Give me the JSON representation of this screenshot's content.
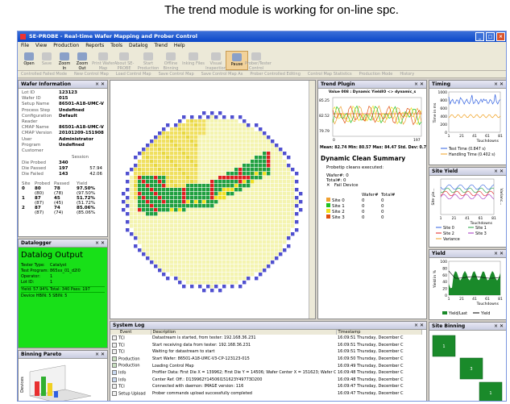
{
  "annotation": "The trend module is working for on-line spc.",
  "title": "SE-PROBE - Real-time Wafer Mapping and Prober Control",
  "menu": [
    "File",
    "View",
    "Production",
    "Reports",
    "Tools",
    "Datalog",
    "Trend",
    "Help"
  ],
  "toolbar": [
    {
      "label": "Open",
      "dis": false
    },
    {
      "label": "Save",
      "dis": true
    },
    {
      "label": "Zoom In",
      "dis": false
    },
    {
      "label": "Zoom Out",
      "dis": false
    },
    {
      "label": "Print Wafer Map",
      "dis": true
    },
    {
      "label": "About SE-PROBE",
      "dis": true
    },
    {
      "label": "Start Production",
      "dis": true
    },
    {
      "label": "Offline Binning",
      "dis": true
    },
    {
      "label": "Inking Files",
      "dis": true
    },
    {
      "label": "Visual Inspection",
      "dis": true
    },
    {
      "label": "Pause",
      "dis": false
    },
    {
      "label": "Prober/Tester Control",
      "dis": true
    }
  ],
  "toolbar2": [
    "Controlled Failed Mode",
    "New Control Map",
    "Load Control Map",
    "Save Control Map",
    "Save Control Map As",
    "Prober Controlled Editing",
    "Control Map Statistics",
    "Production Mode",
    "History"
  ],
  "wafer_info": {
    "title": "Wafer Information",
    "fields": [
      {
        "label": "Lot ID",
        "value": "123123"
      },
      {
        "label": "Wafer ID",
        "value": "015"
      },
      {
        "label": "Setup Name",
        "value": "86501-A18-UMC-V"
      },
      {
        "label": "Process Step",
        "value": "Undefined"
      },
      {
        "label": "Configuration",
        "value": "Default"
      },
      {
        "label": "Reader",
        "value": ""
      },
      {
        "label": "CMAP Name",
        "value": "86501-A18-UMC-V"
      },
      {
        "label": "CMAP Version",
        "value": "20101209-151908"
      },
      {
        "label": "User",
        "value": "Administrator"
      },
      {
        "label": "Program",
        "value": "Undefined"
      },
      {
        "label": "Customer",
        "value": ""
      }
    ],
    "session_label": "Session",
    "counts": [
      {
        "label": "Die Probed",
        "value": "340",
        "pct": ""
      },
      {
        "label": "Die Passed",
        "value": "197",
        "pct": "57.94"
      },
      {
        "label": "Die Failed",
        "value": "143",
        "pct": "42.06"
      }
    ],
    "bin_headers": [
      "Site",
      "Probed",
      "Passed",
      "Yield"
    ],
    "bins": [
      [
        "0",
        "80",
        "78",
        "97.50%"
      ],
      [
        "",
        "(80)",
        "(78)",
        "(97.50%"
      ],
      [
        "1",
        "87",
        "45",
        "51.72%"
      ],
      [
        "",
        "(87)",
        "(45)",
        "(51.72%"
      ],
      [
        "2",
        "87",
        "74",
        "85.06%"
      ],
      [
        "",
        "(87)",
        "(74)",
        "(85.06%"
      ]
    ]
  },
  "datalogger": {
    "title": "Datalogger",
    "heading": "Datalog Output",
    "fields": [
      {
        "label": "Tester Type:",
        "value": "Catalyst"
      },
      {
        "label": "Test Program:",
        "value": "865xx_01_d2l0"
      },
      {
        "label": "Operator:",
        "value": "1"
      },
      {
        "label": "Lot ID:",
        "value": "1"
      }
    ],
    "yield_line": "Yield: 57.94% Total: 340 Pass: 197",
    "device_line": "Device HBIN: 5 SBIN: 5"
  },
  "pareto": {
    "title": "Binning Pareto",
    "ylabel": "Devices"
  },
  "trend": {
    "title": "Trend Plugin",
    "header": "Value 008 : Dynamic YieldIO <> dynamic_s",
    "y_ticks": [
      "85.25",
      "82.52",
      "79.79"
    ],
    "x_ticks": [
      "0",
      "197"
    ],
    "stats": "Mean: 82.74 Min: 80.57 Max: 84.47 Std. Dev: 0.72",
    "summary_title": "Dynamic Clean Summary",
    "summary_line": "Probetip cleans executed:",
    "wafer_line": "Wafer#: 0",
    "total_line": "Total#: 0",
    "fail_device": "Fail Device",
    "site_headers": [
      "Wafer#",
      "Total#"
    ],
    "sites": [
      {
        "name": "Site 0",
        "color": "#f0a030"
      },
      {
        "name": "Site 1",
        "color": "#20c020"
      },
      {
        "name": "Site 2",
        "color": "#f0e020"
      },
      {
        "name": "Site 3",
        "color": "#e05010"
      }
    ]
  },
  "timing": {
    "title": "Timing",
    "y_ticks": [
      "1000",
      "800",
      "600",
      "400",
      "200",
      "0"
    ],
    "x_ticks": [
      "1",
      "21",
      "41",
      "61",
      "81"
    ],
    "xlabel": "Touchdowns",
    "ylabel": "Time in ms",
    "legend": [
      "Test Time (0.847 s)",
      "Handling Time (0.402 s)"
    ]
  },
  "site_yield": {
    "title": "Site Yield",
    "ylabel": "Site yie...",
    "y2label": "Varianc...",
    "x_ticks": [
      "1",
      "21",
      "41",
      "61",
      "81"
    ],
    "xlabel": "Touchdowns",
    "legend": [
      "Site 0",
      "Site 1",
      "Site 2",
      "Site 3",
      "Variance"
    ]
  },
  "yield": {
    "title": "Yield",
    "y_ticks": [
      "100",
      "80",
      "60",
      "40",
      "20",
      "0"
    ],
    "x_ticks": [
      "1",
      "21",
      "41",
      "61",
      "81"
    ],
    "xlabel": "Touchdowns",
    "ylabel": "Yield in %",
    "legend": [
      "Yield/Last",
      "Yield"
    ]
  },
  "site_binning": {
    "title": "Site Binning",
    "cells": [
      "1",
      "3",
      "1"
    ]
  },
  "syslog": {
    "title": "System Log",
    "headers": [
      "Event",
      "Description",
      "Timestamp"
    ],
    "rows": [
      [
        "TCI",
        "Datastream is started, from tester: 192.168.36.231",
        "16:09:51 Thursday, December C"
      ],
      [
        "TCI",
        "Start receiving data from tester: 192.168.36.231",
        "16:09:51 Thursday, December C"
      ],
      [
        "TCI",
        "Waiting for datastream to start",
        "16:09:51 Thursday, December C"
      ],
      [
        "Production",
        "Start Wafer: 86501-A18-UMC-V3-CP-123123-015",
        "16:09:50 Thursday, December C"
      ],
      [
        "Production",
        "Loading Control Map",
        "16:09:49 Thursday, December C"
      ],
      [
        "Info",
        "Profiler Data: First Die X = 139962; First Die Y = 14506; Wafer Center X = 151623; Wafer Center Y = 49773...",
        "16:09:48 Thursday, December C"
      ],
      [
        "Info",
        "Center Ref. Off.: D139962Y14506I151623Y49773D200",
        "16:09:48 Thursday, December C"
      ],
      [
        "TCI",
        "Connected with daemon: IMAGE version: 116",
        "16:09:47 Thursday, December C"
      ],
      [
        "Setup Upload",
        "Prober commands upload successfully completed",
        "16:09:47 Thursday, December C"
      ]
    ]
  }
}
